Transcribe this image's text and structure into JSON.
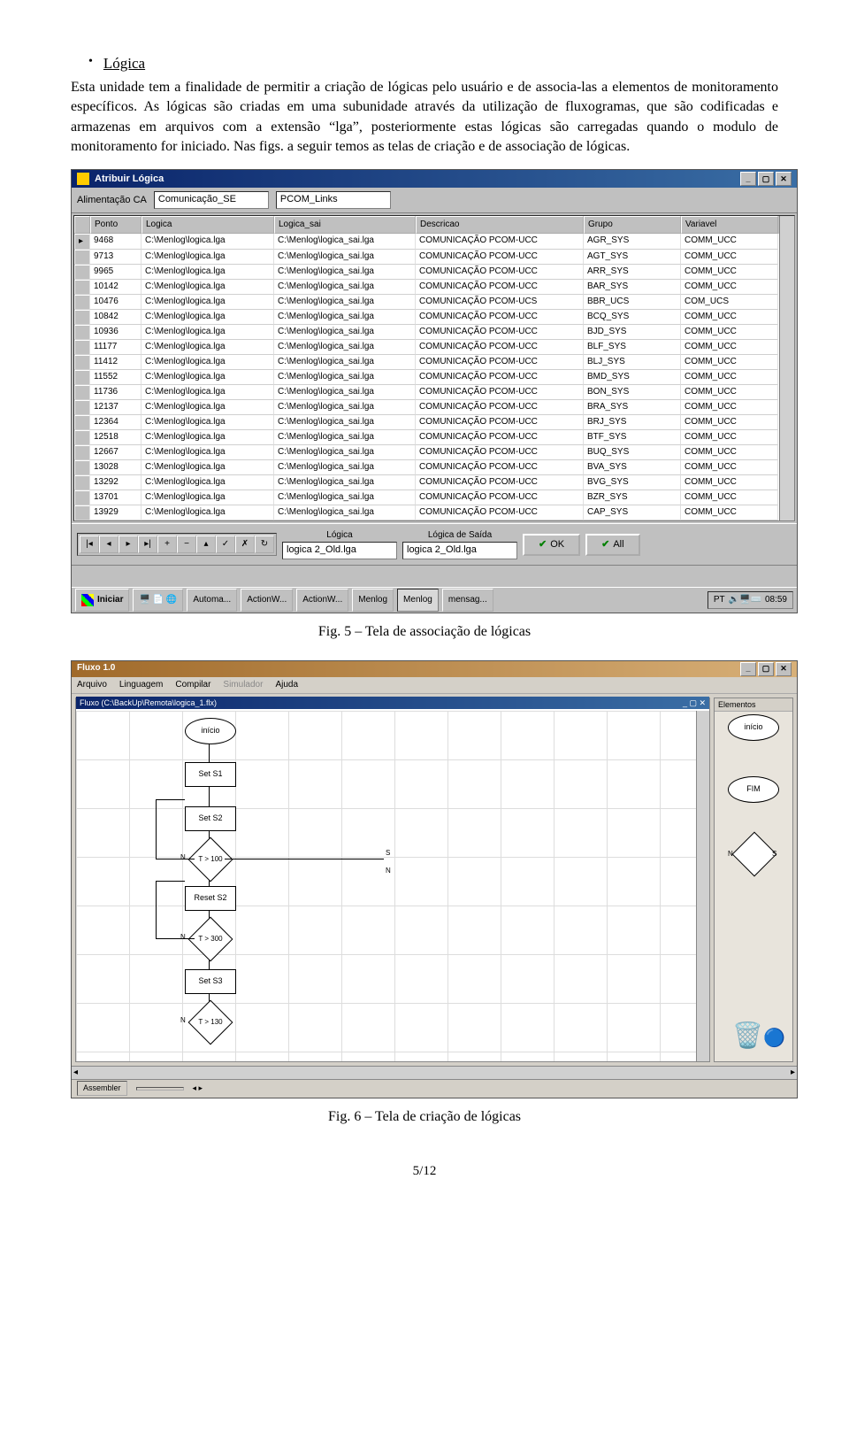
{
  "heading": "Lógica",
  "paragraph": "Esta unidade tem a finalidade de permitir a criação de lógicas pelo usuário e de associa-las a elementos de monitoramento específicos. As lógicas são criadas em uma subunidade através da utilização de fluxogramas, que são codificadas e armazenas em arquivos com a extensão “lga”, posteriormente estas lógicas são carregadas quando o modulo de monitoramento for iniciado. Nas figs. a seguir temos as telas de criação e de associação de lógicas.",
  "fig5_caption": "Fig. 5 – Tela de associação de lógicas",
  "fig6_caption": "Fig. 6 – Tela de criação de lógicas",
  "page_number": "5/12",
  "win1": {
    "title": "Atribuir Lógica",
    "label_alimentacao": "Alimentação CA",
    "input_alimentacao": "Comunicação_SE",
    "input_pcom": "PCOM_Links",
    "columns": [
      "Ponto",
      "Logica",
      "Logica_sai",
      "Descricao",
      "Grupo",
      "Variavel"
    ],
    "rows": [
      {
        "ponto": "9468",
        "logica": "C:\\Menlog\\logica.lga",
        "logica_sai": "C:\\Menlog\\logica_sai.lga",
        "descricao": "COMUNICAÇÃO PCOM-UCC",
        "grupo": "AGR_SYS",
        "variavel": "COMM_UCC"
      },
      {
        "ponto": "9713",
        "logica": "C:\\Menlog\\logica.lga",
        "logica_sai": "C:\\Menlog\\logica_sai.lga",
        "descricao": "COMUNICAÇÃO PCOM-UCC",
        "grupo": "AGT_SYS",
        "variavel": "COMM_UCC"
      },
      {
        "ponto": "9965",
        "logica": "C:\\Menlog\\logica.lga",
        "logica_sai": "C:\\Menlog\\logica_sai.lga",
        "descricao": "COMUNICAÇÃO PCOM-UCC",
        "grupo": "ARR_SYS",
        "variavel": "COMM_UCC"
      },
      {
        "ponto": "10142",
        "logica": "C:\\Menlog\\logica.lga",
        "logica_sai": "C:\\Menlog\\logica_sai.lga",
        "descricao": "COMUNICAÇÃO PCOM-UCC",
        "grupo": "BAR_SYS",
        "variavel": "COMM_UCC"
      },
      {
        "ponto": "10476",
        "logica": "C:\\Menlog\\logica.lga",
        "logica_sai": "C:\\Menlog\\logica_sai.lga",
        "descricao": "COMUNICAÇÃO PCOM-UCS",
        "grupo": "BBR_UCS",
        "variavel": "COM_UCS"
      },
      {
        "ponto": "10842",
        "logica": "C:\\Menlog\\logica.lga",
        "logica_sai": "C:\\Menlog\\logica_sai.lga",
        "descricao": "COMUNICAÇÃO PCOM-UCC",
        "grupo": "BCQ_SYS",
        "variavel": "COMM_UCC"
      },
      {
        "ponto": "10936",
        "logica": "C:\\Menlog\\logica.lga",
        "logica_sai": "C:\\Menlog\\logica_sai.lga",
        "descricao": "COMUNICAÇÃO PCOM-UCC",
        "grupo": "BJD_SYS",
        "variavel": "COMM_UCC"
      },
      {
        "ponto": "11177",
        "logica": "C:\\Menlog\\logica.lga",
        "logica_sai": "C:\\Menlog\\logica_sai.lga",
        "descricao": "COMUNICAÇÃO PCOM-UCC",
        "grupo": "BLF_SYS",
        "variavel": "COMM_UCC"
      },
      {
        "ponto": "11412",
        "logica": "C:\\Menlog\\logica.lga",
        "logica_sai": "C:\\Menlog\\logica_sai.lga",
        "descricao": "COMUNICAÇÃO PCOM-UCC",
        "grupo": "BLJ_SYS",
        "variavel": "COMM_UCC"
      },
      {
        "ponto": "11552",
        "logica": "C:\\Menlog\\logica.lga",
        "logica_sai": "C:\\Menlog\\logica_sai.lga",
        "descricao": "COMUNICAÇÃO PCOM-UCC",
        "grupo": "BMD_SYS",
        "variavel": "COMM_UCC"
      },
      {
        "ponto": "11736",
        "logica": "C:\\Menlog\\logica.lga",
        "logica_sai": "C:\\Menlog\\logica_sai.lga",
        "descricao": "COMUNICAÇÃO PCOM-UCC",
        "grupo": "BON_SYS",
        "variavel": "COMM_UCC"
      },
      {
        "ponto": "12137",
        "logica": "C:\\Menlog\\logica.lga",
        "logica_sai": "C:\\Menlog\\logica_sai.lga",
        "descricao": "COMUNICAÇÃO PCOM-UCC",
        "grupo": "BRA_SYS",
        "variavel": "COMM_UCC"
      },
      {
        "ponto": "12364",
        "logica": "C:\\Menlog\\logica.lga",
        "logica_sai": "C:\\Menlog\\logica_sai.lga",
        "descricao": "COMUNICAÇÃO PCOM-UCC",
        "grupo": "BRJ_SYS",
        "variavel": "COMM_UCC"
      },
      {
        "ponto": "12518",
        "logica": "C:\\Menlog\\logica.lga",
        "logica_sai": "C:\\Menlog\\logica_sai.lga",
        "descricao": "COMUNICAÇÃO PCOM-UCC",
        "grupo": "BTF_SYS",
        "variavel": "COMM_UCC"
      },
      {
        "ponto": "12667",
        "logica": "C:\\Menlog\\logica.lga",
        "logica_sai": "C:\\Menlog\\logica_sai.lga",
        "descricao": "COMUNICAÇÃO PCOM-UCC",
        "grupo": "BUQ_SYS",
        "variavel": "COMM_UCC"
      },
      {
        "ponto": "13028",
        "logica": "C:\\Menlog\\logica.lga",
        "logica_sai": "C:\\Menlog\\logica_sai.lga",
        "descricao": "COMUNICAÇÃO PCOM-UCC",
        "grupo": "BVA_SYS",
        "variavel": "COMM_UCC"
      },
      {
        "ponto": "13292",
        "logica": "C:\\Menlog\\logica.lga",
        "logica_sai": "C:\\Menlog\\logica_sai.lga",
        "descricao": "COMUNICAÇÃO PCOM-UCC",
        "grupo": "BVG_SYS",
        "variavel": "COMM_UCC"
      },
      {
        "ponto": "13701",
        "logica": "C:\\Menlog\\logica.lga",
        "logica_sai": "C:\\Menlog\\logica_sai.lga",
        "descricao": "COMUNICAÇÃO PCOM-UCC",
        "grupo": "BZR_SYS",
        "variavel": "COMM_UCC"
      },
      {
        "ponto": "13929",
        "logica": "C:\\Menlog\\logica.lga",
        "logica_sai": "C:\\Menlog\\logica_sai.lga",
        "descricao": "COMUNICAÇÃO PCOM-UCC",
        "grupo": "CAP_SYS",
        "variavel": "COMM_UCC"
      }
    ],
    "nav": [
      "|◂",
      "◂",
      "▸",
      "▸|",
      "+",
      "−",
      "▴",
      "✓",
      "✗",
      "↻"
    ],
    "label_logica": "Lógica",
    "label_logica_saida": "Lógica de Saída",
    "input_logica": "logica 2_Old.lga",
    "input_logica_saida": "logica 2_Old.lga",
    "btn_ok": "OK",
    "btn_all": "All",
    "taskbar": {
      "start": "Iniciar",
      "items": [
        "Automa...",
        "ActionW...",
        "ActionW...",
        "Menlog",
        "Menlog",
        "mensag..."
      ],
      "tray_icons": "🔊🖥️⌨️",
      "clock": "08:59"
    }
  },
  "win2": {
    "title": "Fluxo 1.0",
    "menu": [
      "Arquivo",
      "Linguagem",
      "Compilar",
      "Simulador",
      "Ajuda"
    ],
    "doc_title": "Fluxo (C:\\BackUp\\Remota\\logica_1.flx)",
    "elementos_label": "Elementos",
    "nodes": {
      "inicio": "início",
      "sets1": "Set S1",
      "sets2": "Set S2",
      "resets2": "Reset S2",
      "sets3": "Set S3",
      "t100": "T > 100",
      "t300": "T > 300",
      "t130": "T > 130",
      "fim": "FIM",
      "n": "N",
      "s": "S"
    },
    "status": "Assembler"
  }
}
